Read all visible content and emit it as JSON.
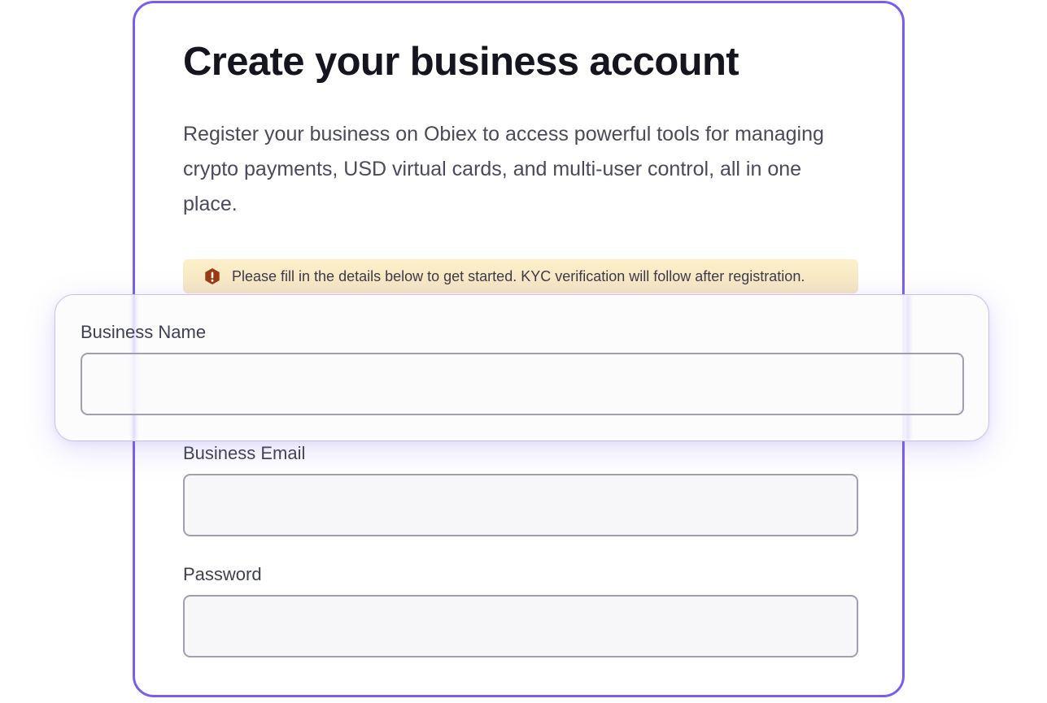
{
  "form": {
    "title": "Create your business account",
    "description": "Register your business on Obiex to access powerful tools for managing crypto payments, USD virtual cards, and multi-user control,  all in one place.",
    "notice": {
      "icon": "warning-icon",
      "text": "Please fill in the details below to get started. KYC verification will follow after registration."
    },
    "fields": {
      "business_name": {
        "label": "Business Name",
        "value": ""
      },
      "business_email": {
        "label": "Business Email",
        "value": ""
      },
      "password": {
        "label": "Password",
        "value": ""
      }
    }
  },
  "colors": {
    "accent": "#7b5cf0",
    "notice_bg": "#fbefc8",
    "warning_icon": "#9b3a12"
  }
}
